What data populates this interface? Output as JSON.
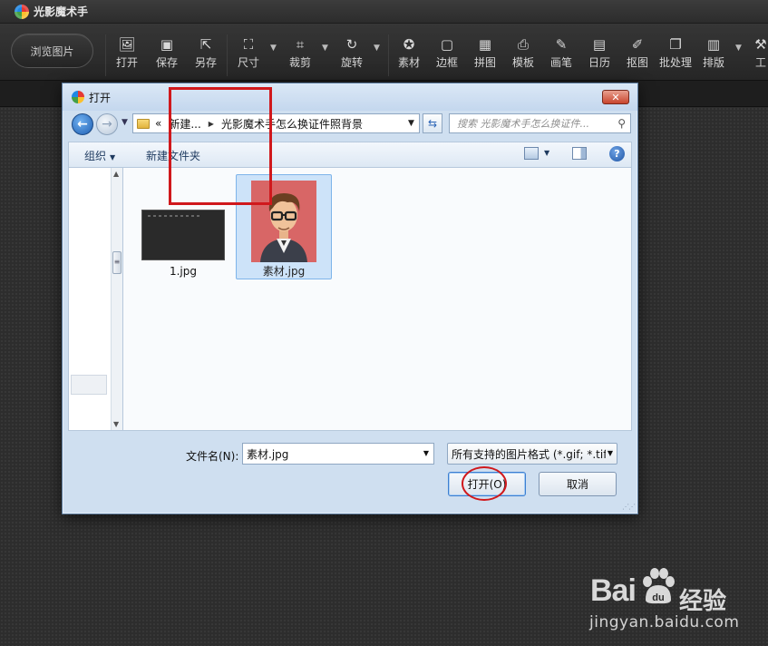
{
  "app": {
    "title": "光影魔术手"
  },
  "toolbar": {
    "browse_label": "浏览图片",
    "items": [
      {
        "label": "打开",
        "icon": "image-open-icon"
      },
      {
        "label": "保存",
        "icon": "save-icon"
      },
      {
        "label": "另存",
        "icon": "save-as-icon"
      },
      {
        "label": "尺寸",
        "icon": "resize-icon"
      },
      {
        "label": "裁剪",
        "icon": "crop-icon"
      },
      {
        "label": "旋转",
        "icon": "rotate-icon"
      },
      {
        "label": "素材",
        "icon": "material-icon"
      },
      {
        "label": "边框",
        "icon": "border-icon"
      },
      {
        "label": "拼图",
        "icon": "puzzle-icon"
      },
      {
        "label": "模板",
        "icon": "template-icon"
      },
      {
        "label": "画笔",
        "icon": "brush-icon"
      },
      {
        "label": "日历",
        "icon": "calendar-icon"
      },
      {
        "label": "抠图",
        "icon": "cutout-icon"
      },
      {
        "label": "批处理",
        "icon": "batch-icon"
      },
      {
        "label": "排版",
        "icon": "layout-icon"
      },
      {
        "label": "工",
        "icon": "tools-icon"
      }
    ]
  },
  "dialog": {
    "title": "打开",
    "close_label": "✕",
    "address": {
      "prefix": "«",
      "segments": [
        "新建...",
        "光影魔术手怎么换证件照背景"
      ]
    },
    "search_placeholder": "搜索 光影魔术手怎么换证件...",
    "commands": {
      "organize": "组织",
      "new_folder": "新建文件夹",
      "help": "?"
    },
    "files": [
      {
        "name": "1.jpg",
        "selected": false
      },
      {
        "name": "素材.jpg",
        "selected": true
      }
    ],
    "filename_label": "文件名(N):",
    "filename_value": "素材.jpg",
    "filetype_value": "所有支持的图片格式 (*.gif; *.tif",
    "open_button": "打开(O)",
    "cancel_button": "取消"
  },
  "watermark": {
    "brand": "Bai",
    "brand_tail": "经验",
    "url": "jingyan.baidu.com"
  }
}
